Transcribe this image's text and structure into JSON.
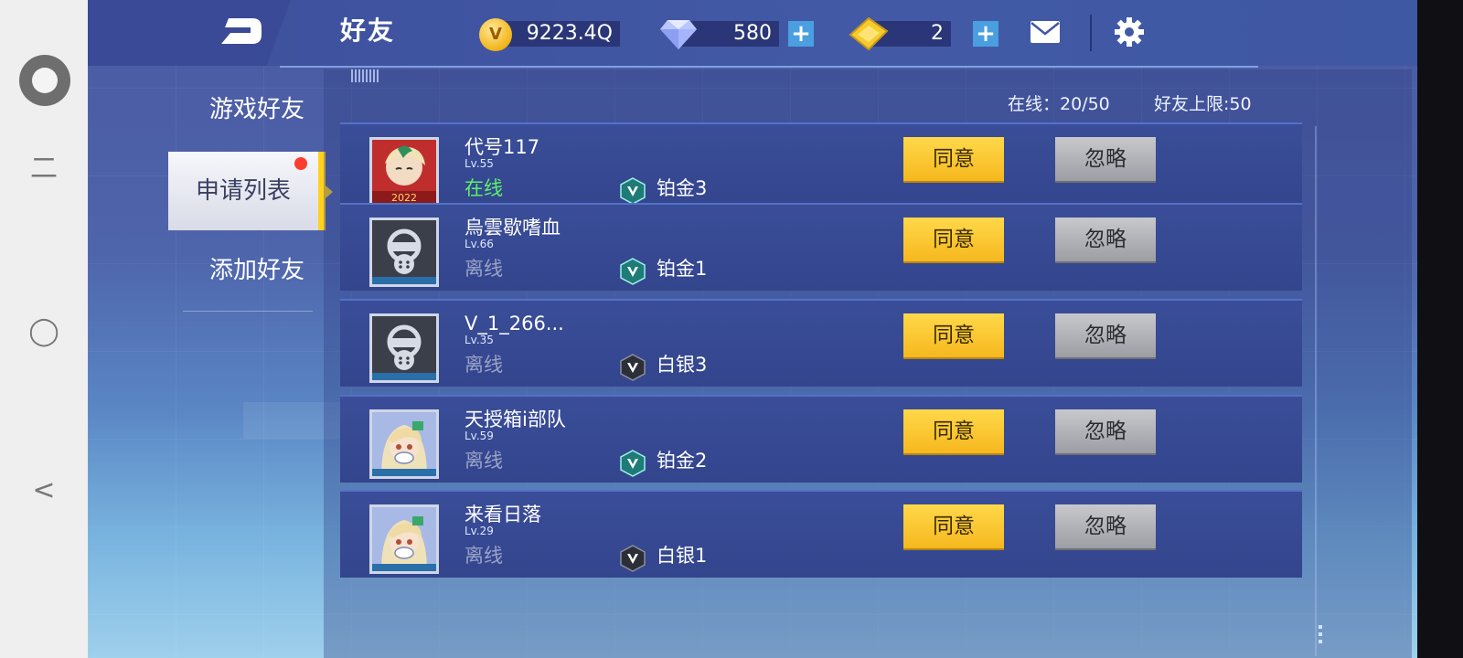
{
  "system": {
    "nav_recent": "二",
    "nav_home": "◯",
    "nav_back": "<"
  },
  "header": {
    "title": "好友",
    "gold": "9223.4Q",
    "diamonds": "580",
    "tickets": "2",
    "coin_symbol": "V"
  },
  "sidebar": {
    "items": [
      {
        "label": "游戏好友",
        "active": false
      },
      {
        "label": "申请列表",
        "active": true
      },
      {
        "label": "添加好友",
        "active": false
      }
    ]
  },
  "stats": {
    "online": "在线：20/50",
    "capacity": "好友上限:50"
  },
  "requests": [
    {
      "name": "代号117",
      "level": "Lv.55",
      "status": "在线",
      "rank": "铂金3",
      "avatar": "event-girl",
      "rank_tier": "platinum"
    },
    {
      "name": "烏雲歇嗜血",
      "level": "Lv.66",
      "status": "离线",
      "rank": "铂金1",
      "avatar": "gasmask",
      "rank_tier": "platinum"
    },
    {
      "name": "V_1_266...",
      "level": "Lv.35",
      "status": "离线",
      "rank": "白银3",
      "avatar": "gasmask",
      "rank_tier": "silver"
    },
    {
      "name": "天授箱i部队",
      "level": "Lv.59",
      "status": "离线",
      "rank": "铂金2",
      "avatar": "girl",
      "rank_tier": "platinum"
    },
    {
      "name": "来看日落",
      "level": "Lv.29",
      "status": "离线",
      "rank": "白银1",
      "avatar": "girl",
      "rank_tier": "silver"
    }
  ],
  "actions": {
    "agree": "同意",
    "ignore": "忽略"
  },
  "event_badge": "2022",
  "colors": {
    "online": "#5df06a",
    "offline": "#9aa3c8",
    "agree": "#f8c63a",
    "ignore": "#b4b6bc",
    "notify_dot": "#ff3b30"
  }
}
